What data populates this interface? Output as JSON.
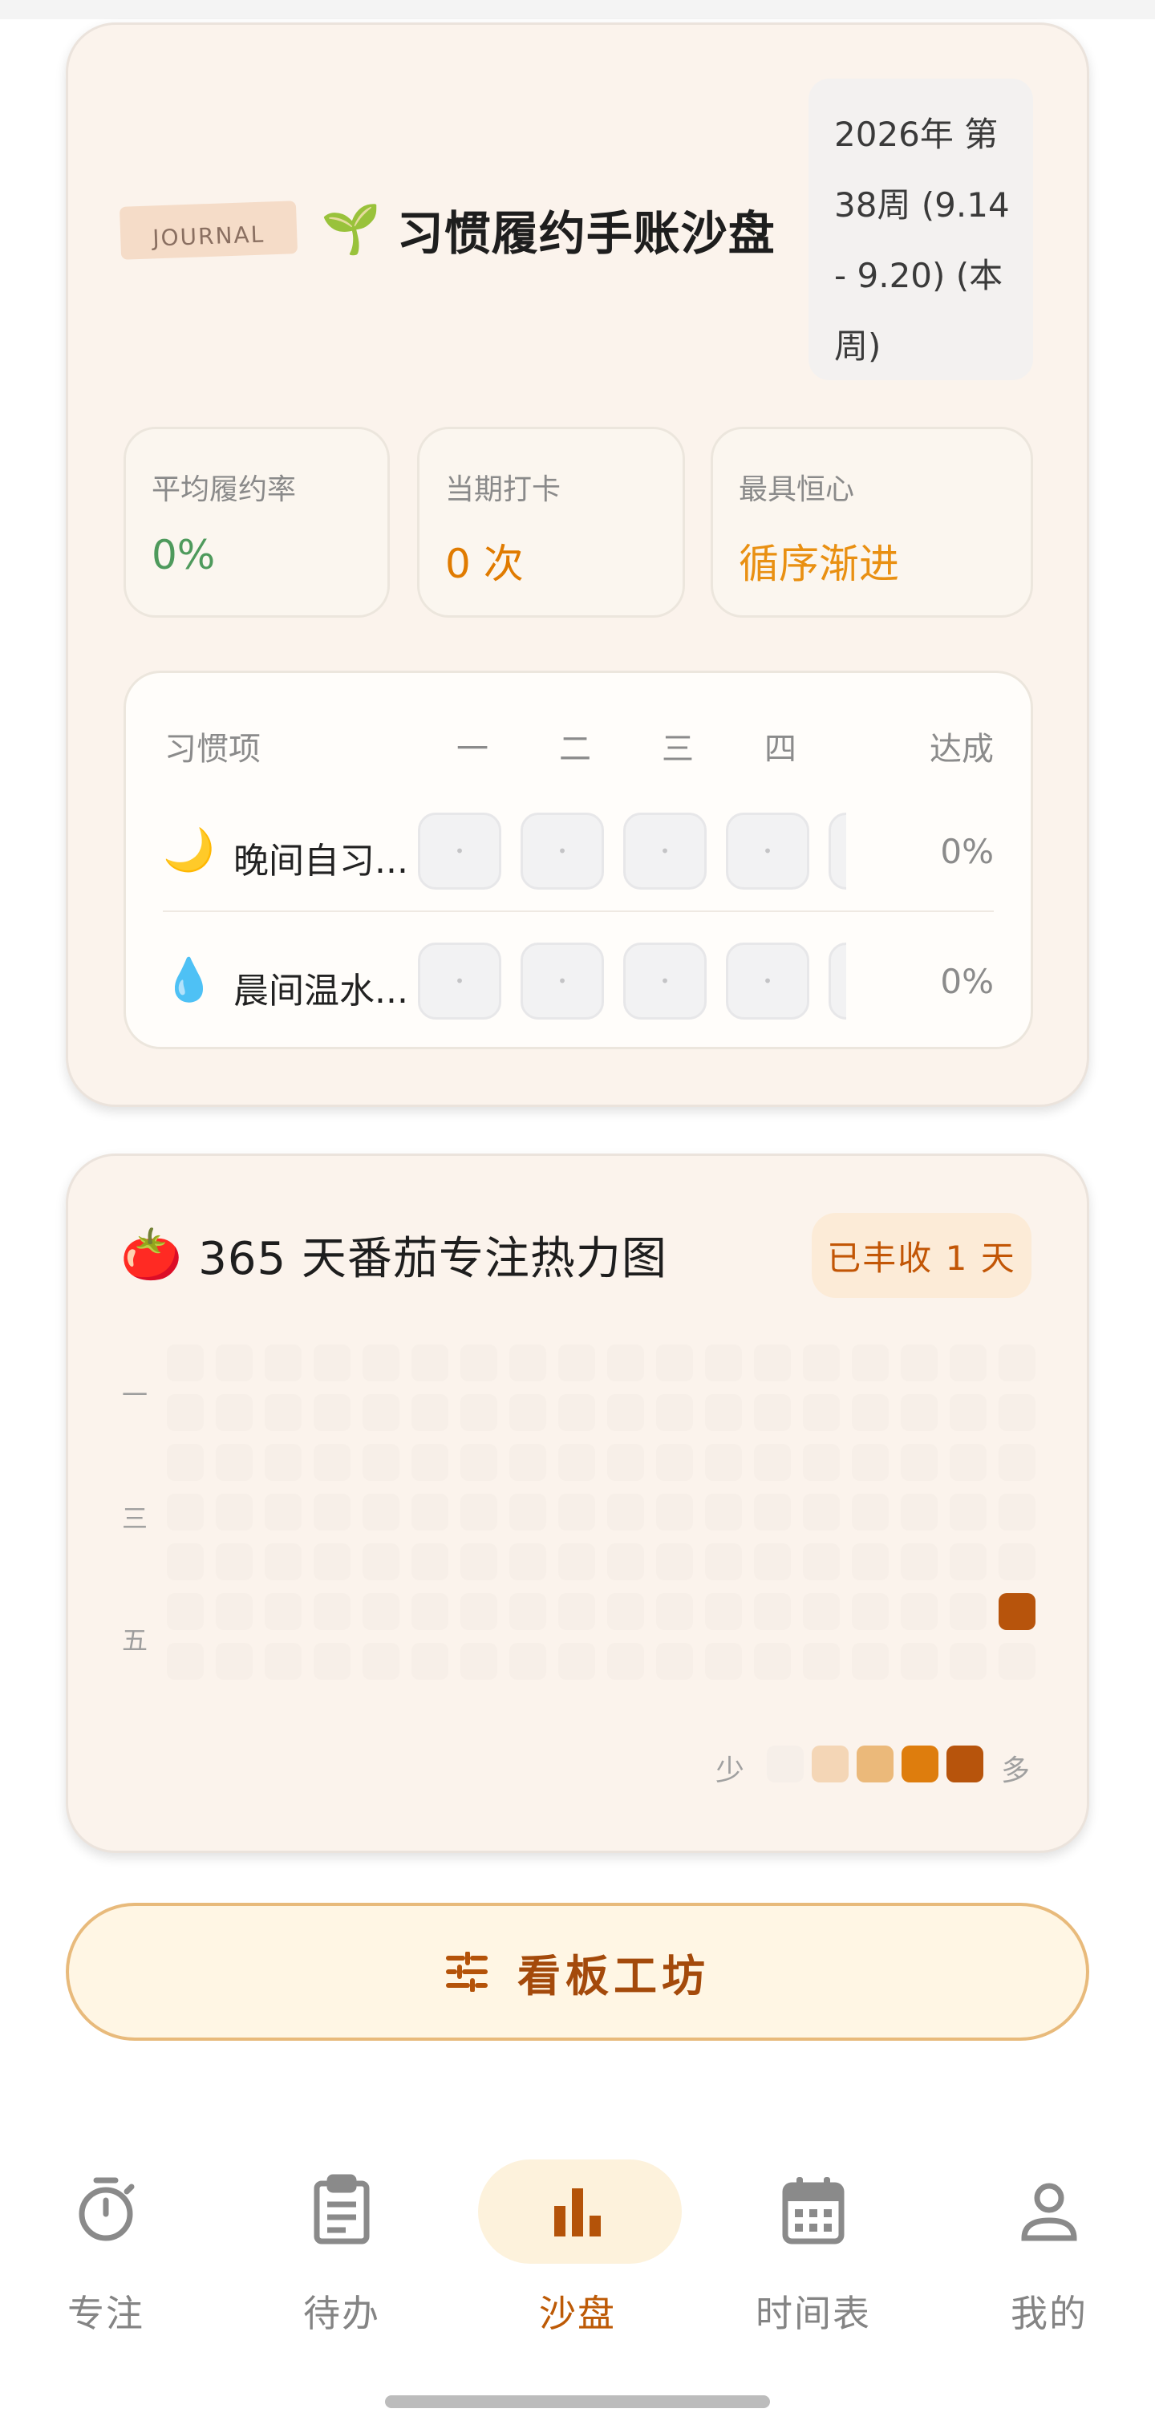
{
  "habit_card": {
    "tag": "JOURNAL",
    "title_icon": "🌱",
    "title": "习惯履约手账沙盘",
    "week_range": "2026年 第38周 (9.14 - 9.20) (本周)",
    "stats": [
      {
        "label": "平均履约率",
        "value": "0%"
      },
      {
        "label": "当期打卡",
        "value": "0 次"
      },
      {
        "label": "最具恒心",
        "value": "循序渐进"
      }
    ],
    "table": {
      "header_item": "习惯项",
      "days": [
        "一",
        "二",
        "三",
        "四"
      ],
      "header_rate": "达成",
      "rows": [
        {
          "icon": "🌙",
          "name": "晚间自习...",
          "cells": [
            "•",
            "•",
            "•",
            "•"
          ],
          "rate": "0%"
        },
        {
          "icon": "💧",
          "name": "晨间温水...",
          "cells": [
            "•",
            "•",
            "•",
            "•"
          ],
          "rate": "0%"
        }
      ]
    }
  },
  "heatmap_card": {
    "title_icon": "🍅",
    "title": "365 天番茄专注热力图",
    "badge": "已丰收 1 天",
    "day_labels": [
      "一",
      "三",
      "五"
    ],
    "legend": {
      "less": "少",
      "more": "多",
      "colors": [
        "#f6efe9",
        "#f4d6b6",
        "#ebb97a",
        "#de7d0d",
        "#b7540c"
      ]
    },
    "empty_color": "#f7efe8",
    "highlight": {
      "week": 17,
      "day": 5,
      "level": 4
    }
  },
  "workshop_button": {
    "label": "看板工坊",
    "icon": "sliders-icon"
  },
  "nav": {
    "items": [
      {
        "label": "专注",
        "icon": "timer-icon"
      },
      {
        "label": "待办",
        "icon": "clipboard-icon"
      },
      {
        "label": "沙盘",
        "icon": "bar-chart-icon"
      },
      {
        "label": "时间表",
        "icon": "calendar-icon"
      },
      {
        "label": "我的",
        "icon": "user-icon"
      }
    ],
    "active": "沙盘"
  }
}
